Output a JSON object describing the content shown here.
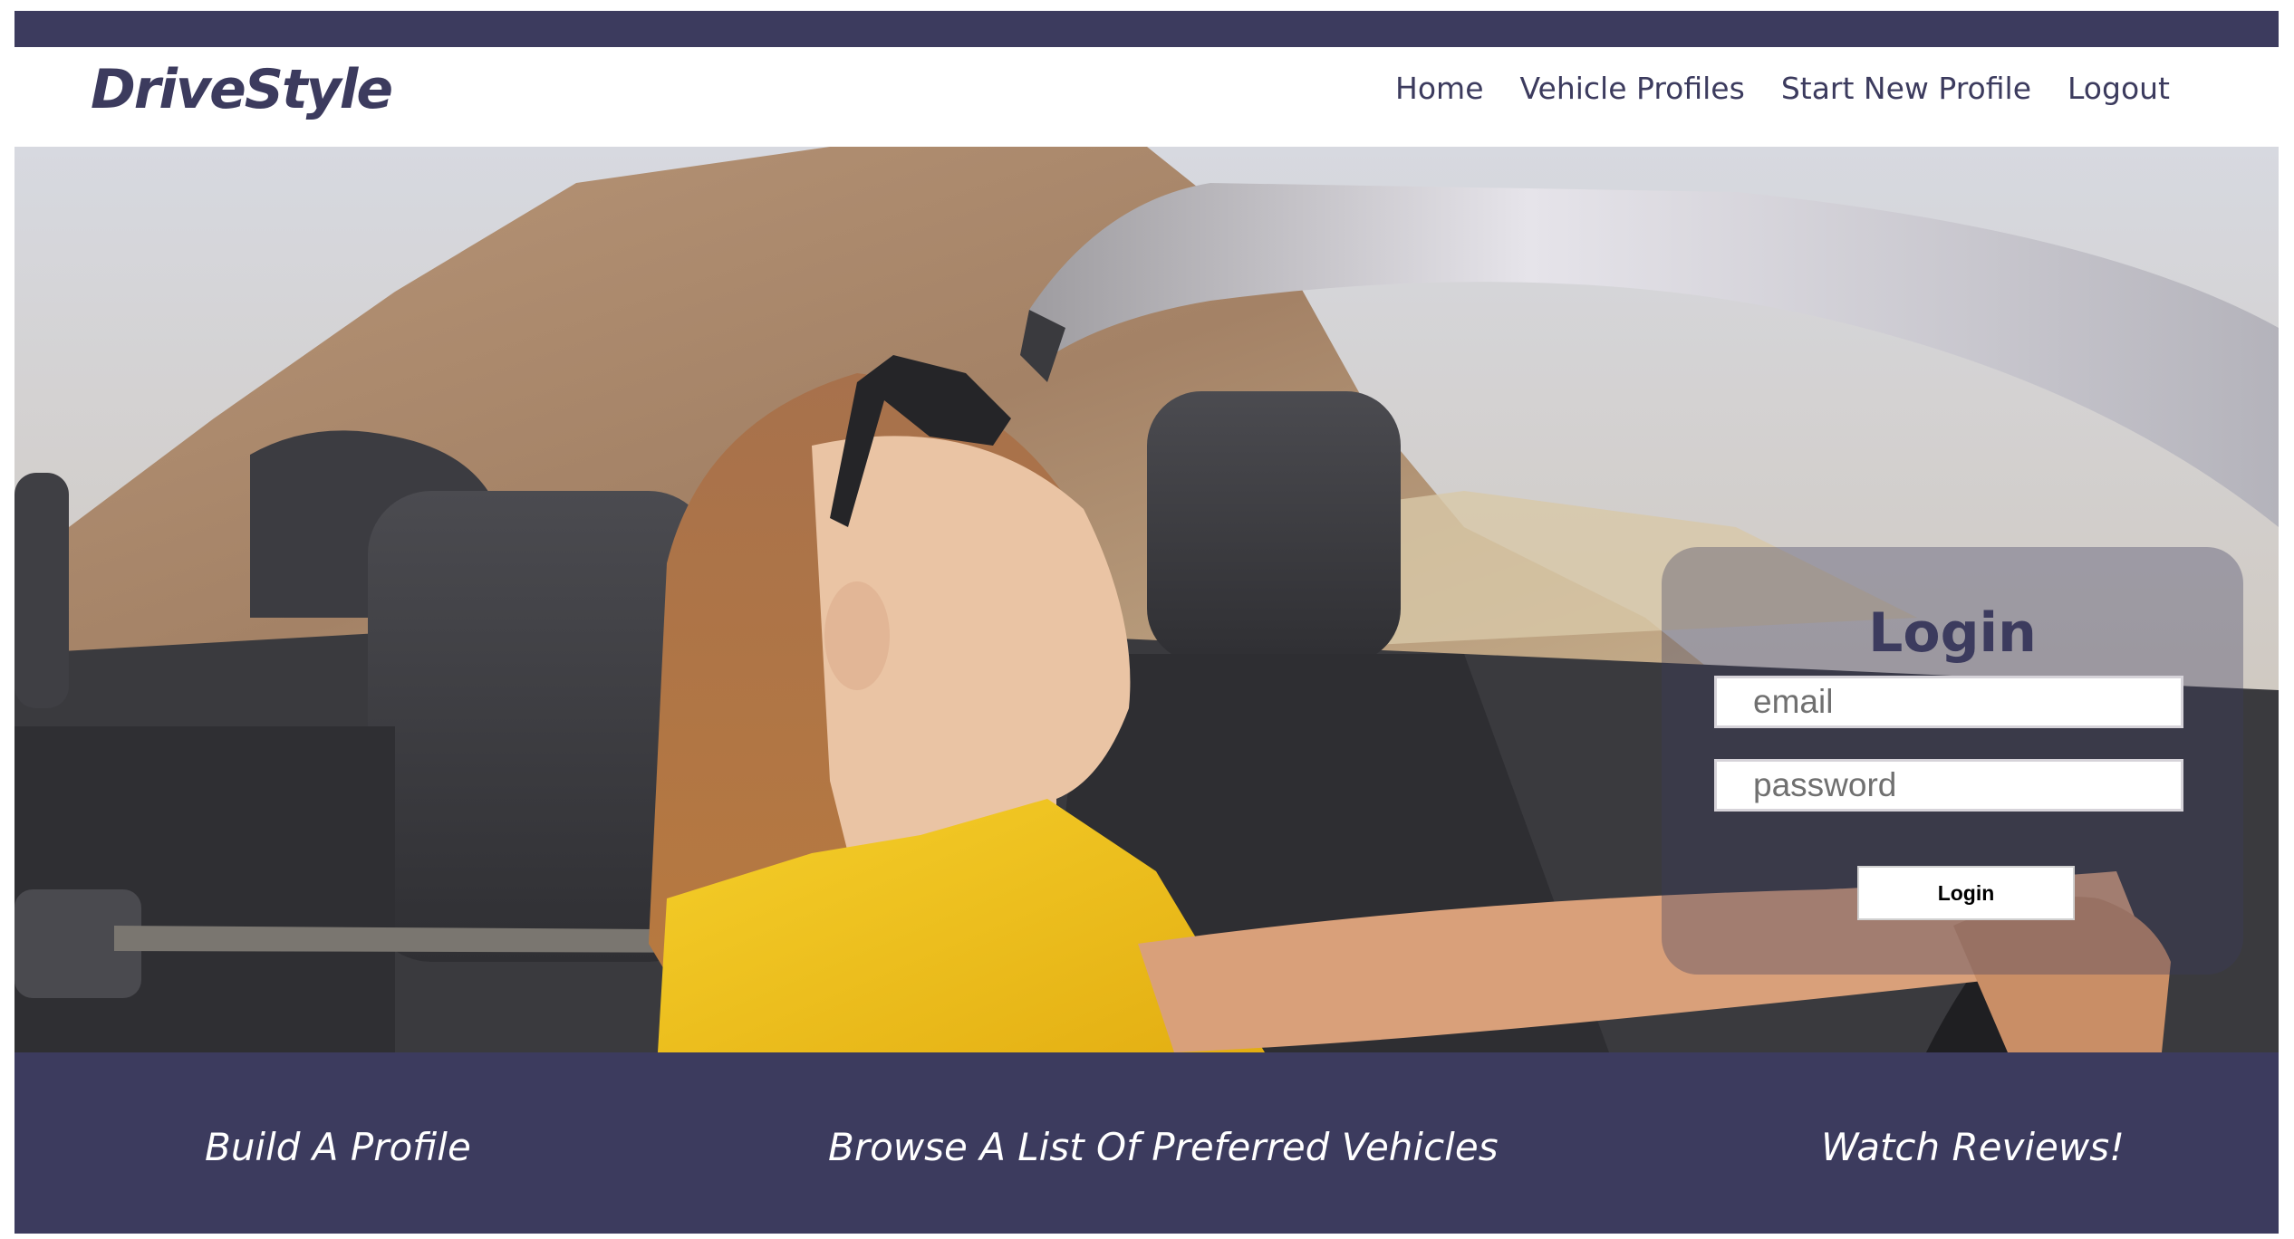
{
  "brand": {
    "name": "DriveStyle",
    "color": "#3c3b5e"
  },
  "nav": {
    "items": [
      {
        "label": "Home"
      },
      {
        "label": "Vehicle Profiles"
      },
      {
        "label": "Start New Profile"
      },
      {
        "label": "Logout"
      }
    ]
  },
  "hero": {
    "image": "woman-driving-convertible-photo"
  },
  "login": {
    "title": "Login",
    "email_placeholder": "email",
    "password_placeholder": "password",
    "button_label": "Login"
  },
  "features": {
    "items": [
      {
        "label": "Build A Profile"
      },
      {
        "label": "Browse A List Of Preferred Vehicles"
      },
      {
        "label": "Watch Reviews!"
      }
    ]
  }
}
